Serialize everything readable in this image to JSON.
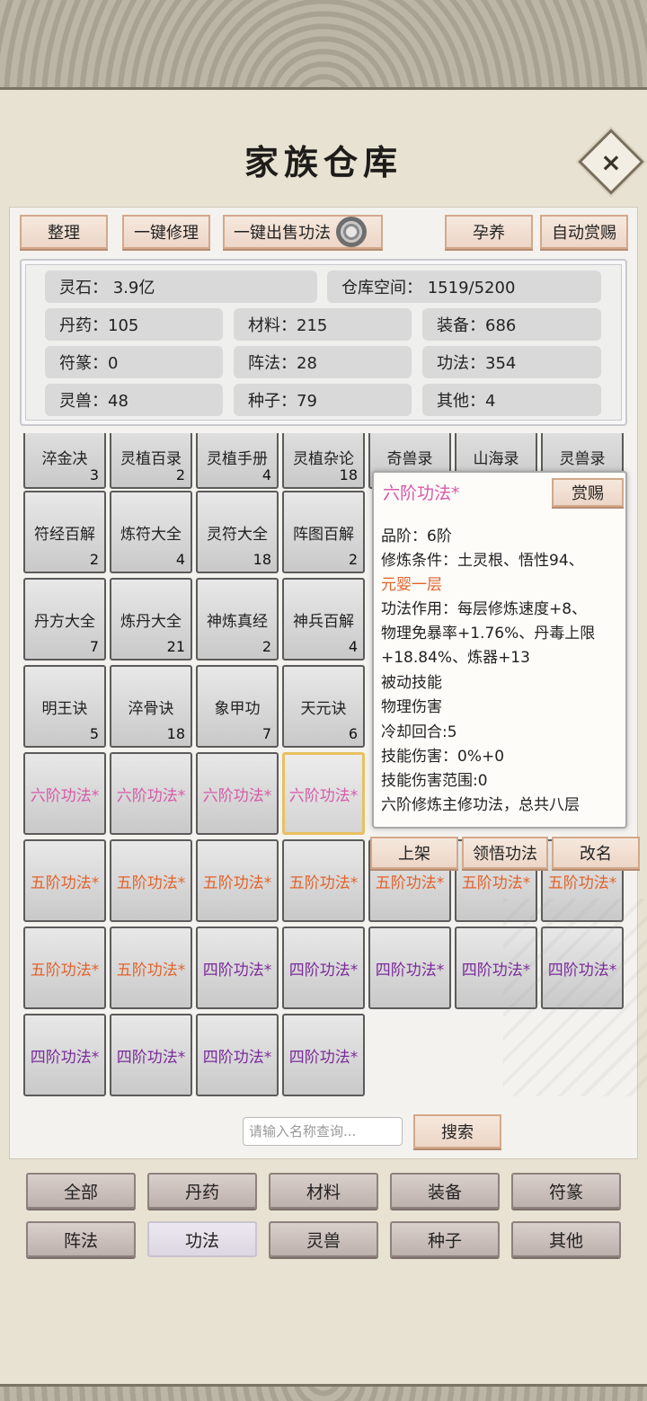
{
  "title": "家族仓库",
  "close_icon": "×",
  "toolbar": {
    "sort": "整理",
    "repair_all": "一键修理",
    "sell_all": "一键出售功法",
    "nurture": "孕养",
    "auto_reward": "自动赏赐"
  },
  "stats": {
    "spirit_stone": "灵石： 3.9亿",
    "capacity": "仓库空间：     1519/5200",
    "pills": "丹药：105",
    "materials": "材料：215",
    "equipment": "装备：686",
    "talismans": "符篆：0",
    "formations": "阵法：28",
    "skills": "功法：354",
    "beasts": "灵兽：48",
    "seeds": "种子：79",
    "others": "其他：4"
  },
  "grid": {
    "row0": [
      {
        "name": "淬金决",
        "count": "3"
      },
      {
        "name": "灵植百录",
        "count": "2"
      },
      {
        "name": "灵植手册",
        "count": "4"
      },
      {
        "name": "灵植杂论",
        "count": "18"
      },
      {
        "name": "奇兽录",
        "count": ""
      },
      {
        "name": "山海录",
        "count": ""
      },
      {
        "name": "灵兽录",
        "count": ""
      }
    ],
    "row1": [
      {
        "name": "符经百解",
        "count": "2"
      },
      {
        "name": "炼符大全",
        "count": "4"
      },
      {
        "name": "灵符大全",
        "count": "18"
      },
      {
        "name": "阵图百解",
        "count": "2"
      }
    ],
    "row2": [
      {
        "name": "丹方大全",
        "count": "7"
      },
      {
        "name": "炼丹大全",
        "count": "21"
      },
      {
        "name": "神炼真经",
        "count": "2"
      },
      {
        "name": "神兵百解",
        "count": "4"
      }
    ],
    "row3": [
      {
        "name": "明王诀",
        "count": "5"
      },
      {
        "name": "淬骨诀",
        "count": "18"
      },
      {
        "name": "象甲功",
        "count": "7"
      },
      {
        "name": "天元诀",
        "count": "6"
      }
    ],
    "six_tier": "六阶功法*",
    "five_tier": "五阶功法*",
    "four_tier": "四阶功法*"
  },
  "tooltip": {
    "title": "六阶功法*",
    "reward_button": "赏赐",
    "grade": "品阶：6阶",
    "condition": "修炼条件：土灵根、悟性94、",
    "condition_realm": "元婴一层",
    "effect1": "功法作用：每层修炼速度+8、",
    "effect2": "物理免暴率+1.76%、丹毒上限",
    "effect3": "+18.84%、炼器+13",
    "passive": "被动技能",
    "damage_type": "物理伤害",
    "cooldown": "冷却回合:5",
    "skill_damage": "技能伤害：0%+0",
    "skill_range": "技能伤害范围:0",
    "desc": "六阶修炼主修功法，总共八层"
  },
  "actions": {
    "list": "上架",
    "comprehend": "领悟功法",
    "rename": "改名"
  },
  "search": {
    "placeholder": "请输入名称查询...",
    "button": "搜索"
  },
  "tabs": {
    "all": "全部",
    "pills": "丹药",
    "materials": "材料",
    "equipment": "装备",
    "talismans": "符篆",
    "formations": "阵法",
    "skills": "功法",
    "beasts": "灵兽",
    "seeds": "种子",
    "others": "其他"
  },
  "colors": {
    "six_tier": "#d65aa8",
    "five_tier": "#e2622a",
    "four_tier": "#7a2a9a",
    "realm_highlight": "#e2622a"
  }
}
